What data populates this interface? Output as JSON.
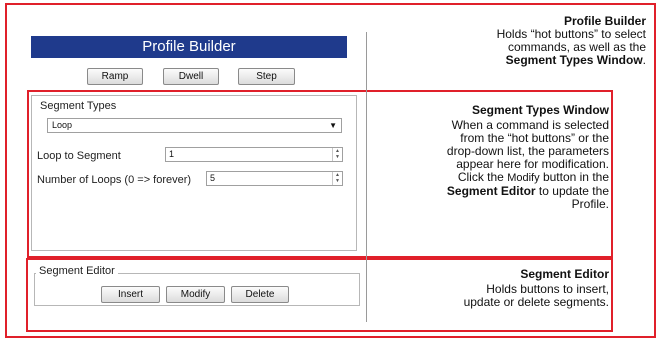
{
  "profile_builder": {
    "header_title": "Profile Builder",
    "buttons": [
      "Ramp",
      "Dwell",
      "Step"
    ]
  },
  "segment_types": {
    "title": "Segment Types",
    "selected": "Loop",
    "fields": [
      {
        "label": "Loop to Segment",
        "value": "1"
      },
      {
        "label": "Number of Loops (0 => forever)",
        "value": "5"
      }
    ]
  },
  "segment_editor": {
    "title": "Segment Editor",
    "buttons": [
      "Insert",
      "Modify",
      "Delete"
    ]
  },
  "annotations": {
    "profile_builder": {
      "title": "Profile Builder",
      "line1": "Holds “hot buttons” to select",
      "line2": "commands, as well as the",
      "line3": "Segment Types Window",
      "line3_suffix": "."
    },
    "segment_types_window": {
      "title": "Segment Types Window",
      "line1": "When a command is selected",
      "line2": "from the “hot buttons” or the",
      "line3": "drop-down list, the parameters",
      "line4": "appear here for modification.",
      "line5_pre": "Click the ",
      "line5_modify": "Modify",
      "line5_post": " button in the",
      "line6_bold": "Segment Editor",
      "line6_post": " to update the",
      "line7": "Profile."
    },
    "segment_editor": {
      "title": "Segment Editor",
      "line1": "Holds buttons to insert,",
      "line2": "update or delete segments."
    }
  },
  "colors": {
    "highlight": "#e0202a",
    "header": "#1f3a8c"
  }
}
